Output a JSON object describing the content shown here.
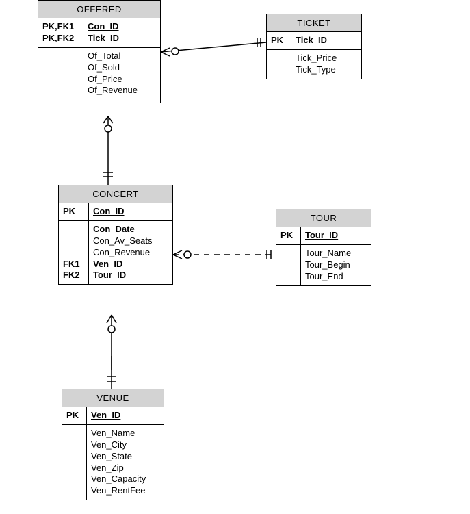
{
  "entities": {
    "offered": {
      "title": "OFFERED",
      "keys_sec1": [
        "PK,FK1",
        "PK,FK2"
      ],
      "attrs_sec1": [
        "Con_ID",
        "Tick_ID"
      ],
      "keys_sec2": [],
      "attrs_sec2": [
        "Of_Total",
        "Of_Sold",
        "Of_Price",
        "Of_Revenue"
      ]
    },
    "ticket": {
      "title": "TICKET",
      "keys_sec1": [
        "PK"
      ],
      "attrs_sec1": [
        "Tick_ID"
      ],
      "attrs_sec2": [
        "Tick_Price",
        "Tick_Type"
      ]
    },
    "concert": {
      "title": "CONCERT",
      "keys_sec1": [
        "PK"
      ],
      "attrs_sec1": [
        "Con_ID"
      ],
      "keys_sec2": [
        "",
        "",
        "",
        "FK1",
        "FK2"
      ],
      "attrs_sec2": [
        "Con_Date",
        "Con_Av_Seats",
        "Con_Revenue",
        "Ven_ID",
        "Tour_ID"
      ]
    },
    "tour": {
      "title": "TOUR",
      "keys_sec1": [
        "PK"
      ],
      "attrs_sec1": [
        "Tour_ID"
      ],
      "attrs_sec2": [
        "Tour_Name",
        "Tour_Begin",
        "Tour_End"
      ]
    },
    "venue": {
      "title": "VENUE",
      "keys_sec1": [
        "PK"
      ],
      "attrs_sec1": [
        "Ven_ID"
      ],
      "attrs_sec2": [
        "Ven_Name",
        "Ven_City",
        "Ven_State",
        "Ven_Zip",
        "Ven_Capacity",
        "Ven_RentFee"
      ]
    }
  }
}
